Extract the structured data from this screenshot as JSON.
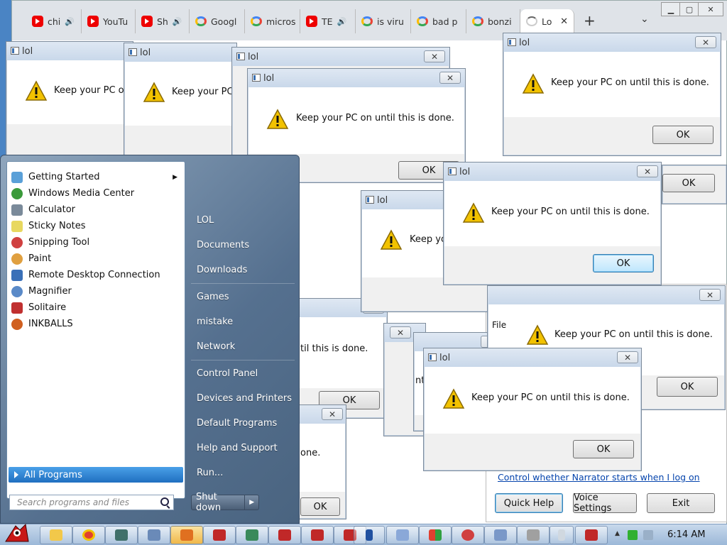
{
  "browser": {
    "tabs": [
      {
        "label": "chi",
        "icon": "youtube-icon",
        "audio": true
      },
      {
        "label": "YouTu",
        "icon": "youtube-icon",
        "audio": true
      },
      {
        "label": "Sh",
        "icon": "youtube-icon",
        "audio": true
      },
      {
        "label": "Googl",
        "icon": "google-icon",
        "audio": false
      },
      {
        "label": "micros",
        "icon": "google-icon",
        "audio": false
      },
      {
        "label": "TE",
        "icon": "youtube-icon",
        "audio": true
      },
      {
        "label": "is viru",
        "icon": "google-icon",
        "audio": false
      },
      {
        "label": "bad p",
        "icon": "google-icon",
        "audio": false
      },
      {
        "label": "bonzi",
        "icon": "google-icon",
        "audio": false
      },
      {
        "label": "Lo",
        "icon": "loading-icon",
        "audio": false,
        "active": true
      }
    ],
    "new_tab_label": "+",
    "tab_menu_label": "⌄"
  },
  "dialog": {
    "title": "lol",
    "message": "Keep your PC on until this is done.",
    "ok_label": "OK"
  },
  "partial_text": {
    "til_done": "til this is done.",
    "one_done": "one.",
    "keep_yo": "Keep yo",
    "keep_your_pc_on": "Keep your PC on",
    "keep_your_pc": "Keep your PC",
    "file": "File",
    "nti": "nti"
  },
  "narrator": {
    "link": "Control whether Narrator starts when I log on",
    "quick_help": "Quick Help",
    "voice_settings": "Voice Settings",
    "exit": "Exit"
  },
  "start_menu": {
    "programs": [
      {
        "label": "Getting Started",
        "icon": "getting-started-icon",
        "color": "#5aa0d8",
        "submenu": true
      },
      {
        "label": "Windows Media Center",
        "icon": "media-center-icon",
        "color": "#3a9a3a",
        "submenu": false
      },
      {
        "label": "Calculator",
        "icon": "calculator-icon",
        "color": "#7a8a9a",
        "submenu": false
      },
      {
        "label": "Sticky Notes",
        "icon": "sticky-notes-icon",
        "color": "#e8d860",
        "submenu": false
      },
      {
        "label": "Snipping Tool",
        "icon": "snipping-tool-icon",
        "color": "#d04040",
        "submenu": false
      },
      {
        "label": "Paint",
        "icon": "paint-icon",
        "color": "#e0a040",
        "submenu": false
      },
      {
        "label": "Remote Desktop Connection",
        "icon": "remote-desktop-icon",
        "color": "#3a70b8",
        "submenu": false
      },
      {
        "label": "Magnifier",
        "icon": "magnifier-icon",
        "color": "#5a8ac8",
        "submenu": false
      },
      {
        "label": "Solitaire",
        "icon": "solitaire-icon",
        "color": "#c03030",
        "submenu": false
      },
      {
        "label": "INKBALLS",
        "icon": "inkballs-icon",
        "color": "#d06020",
        "submenu": false
      }
    ],
    "all_programs": "All Programs",
    "search_placeholder": "Search programs and files",
    "right_links": [
      "LOL",
      "Documents",
      "Downloads",
      "Games",
      "mistake",
      "Network",
      "Control Panel",
      "Devices and Printers",
      "Default Programs",
      "Help and Support",
      "Run..."
    ],
    "shutdown": "Shut down"
  },
  "taskbar": {
    "clock": "6:14 AM"
  }
}
